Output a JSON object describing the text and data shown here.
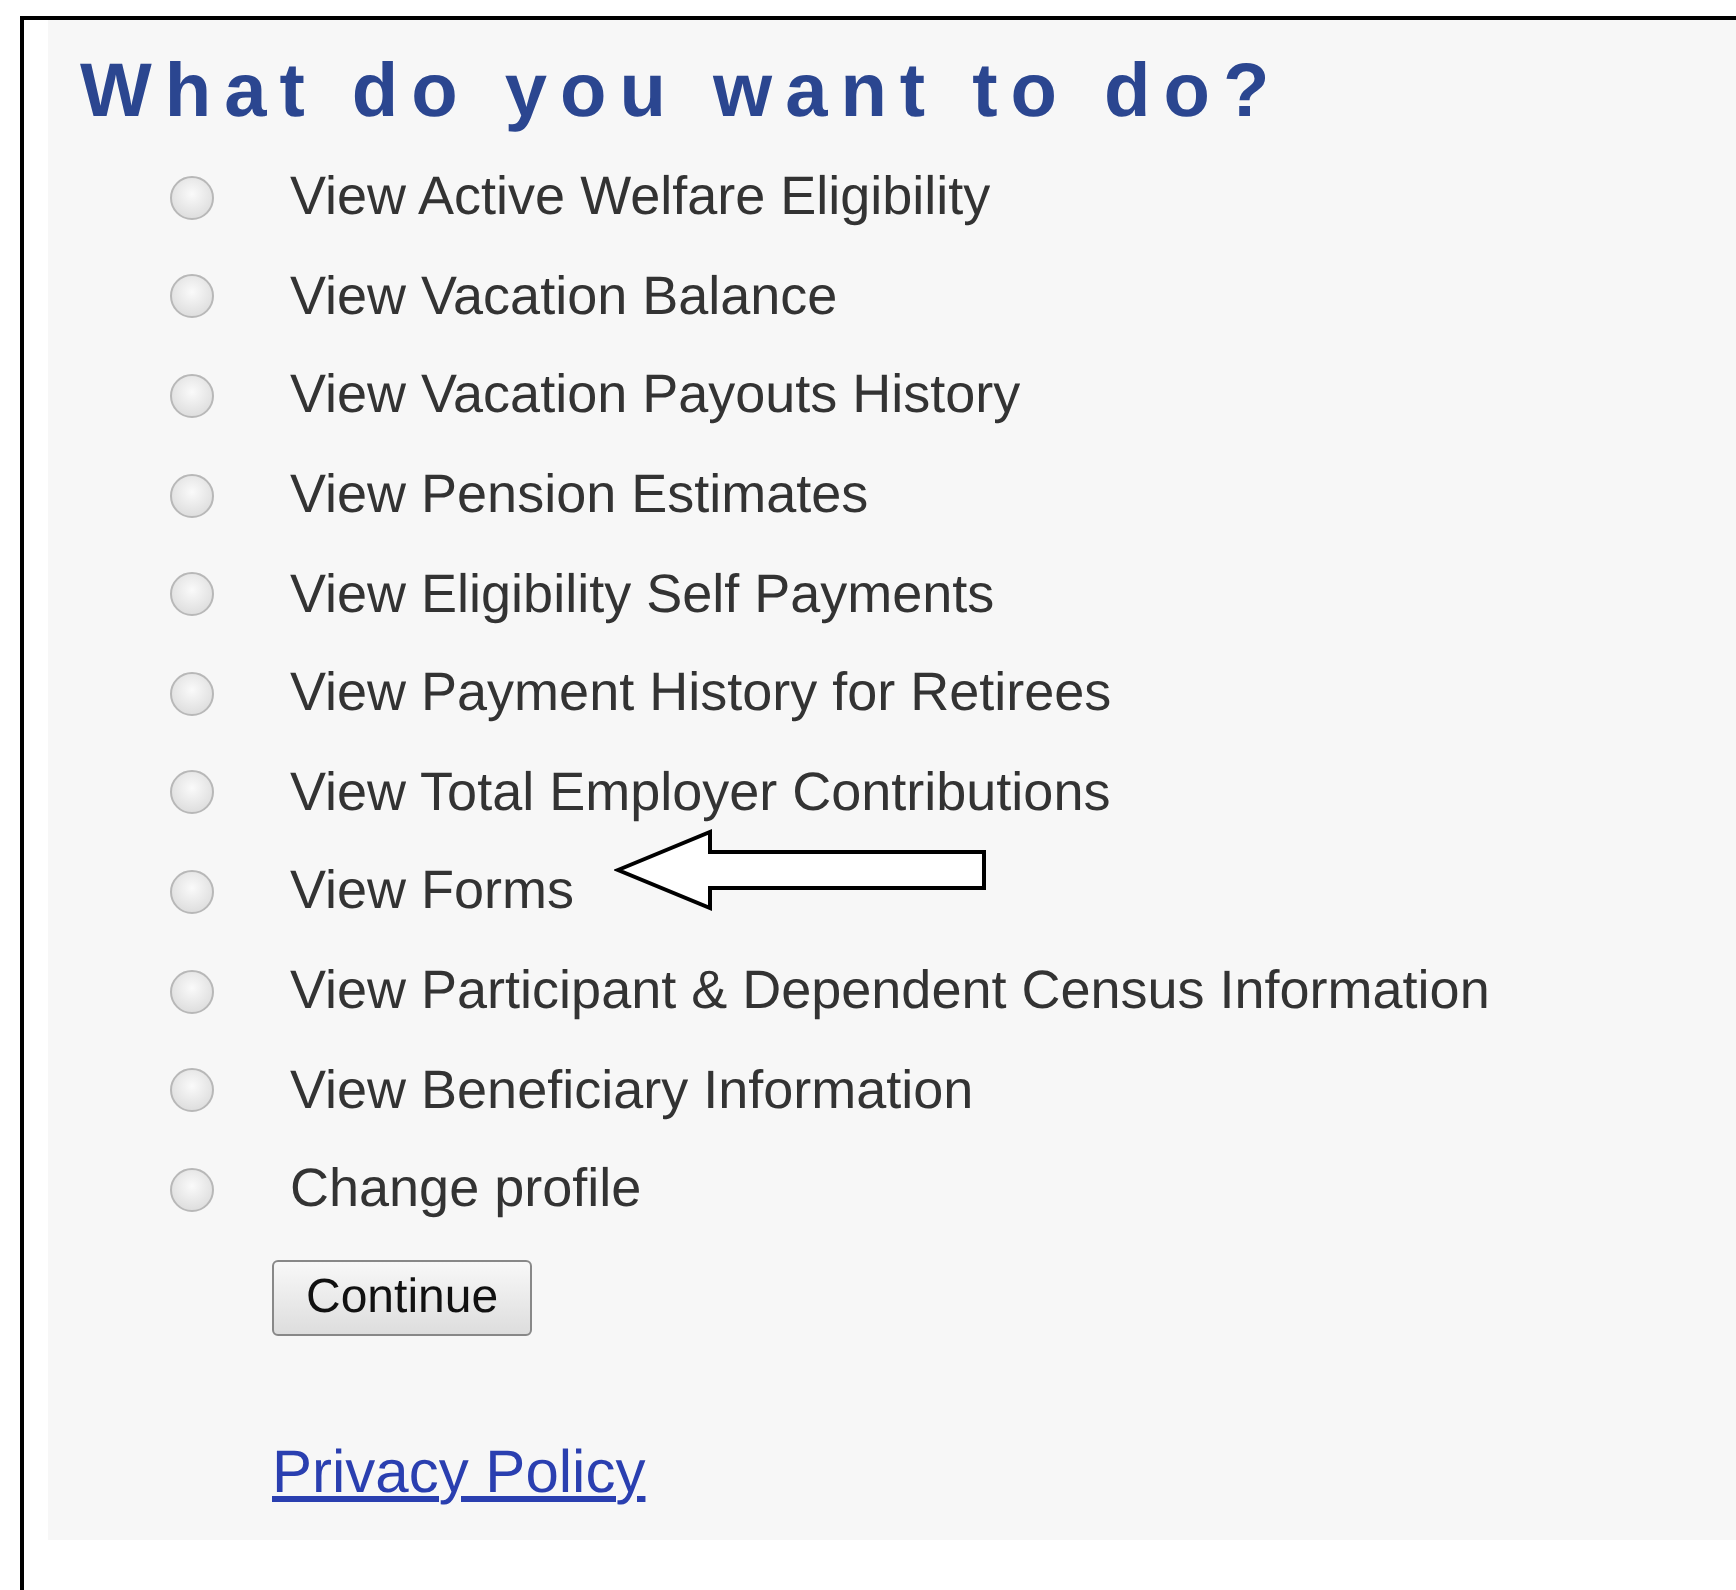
{
  "heading": "What do you want to do?",
  "options": [
    {
      "label": "View Active Welfare Eligibility",
      "selected": false
    },
    {
      "label": "View Vacation Balance",
      "selected": false
    },
    {
      "label": "View Vacation Payouts History",
      "selected": false
    },
    {
      "label": "View Pension Estimates",
      "selected": false
    },
    {
      "label": "View Eligibility Self Payments",
      "selected": false
    },
    {
      "label": "View Payment History for Retirees",
      "selected": false
    },
    {
      "label": "View Total Employer Contributions",
      "selected": false
    },
    {
      "label": "View Forms",
      "selected": false
    },
    {
      "label": "View Participant & Dependent Census Information",
      "selected": false
    },
    {
      "label": "View Beneficiary Information",
      "selected": false
    },
    {
      "label": "Change profile",
      "selected": false
    }
  ],
  "button": "Continue",
  "link": "Privacy Policy"
}
